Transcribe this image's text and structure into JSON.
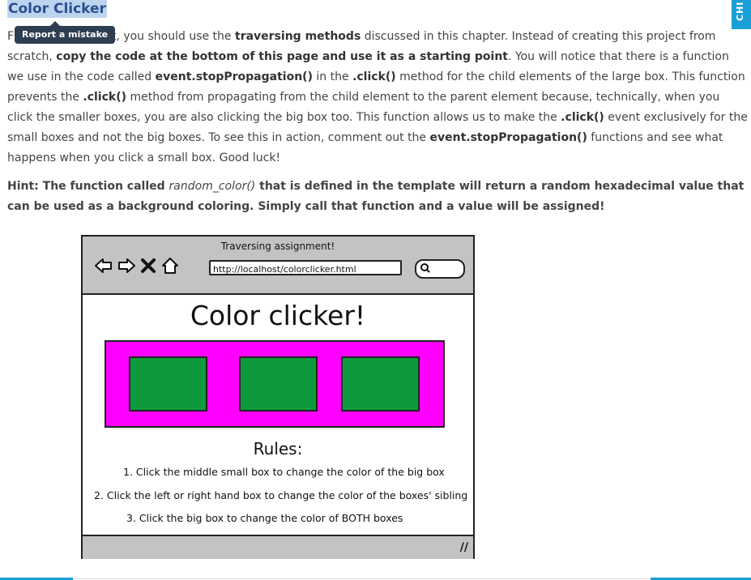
{
  "section_title": "Color Clicker",
  "tooltip": "Report a mistake",
  "side_tab": "CHI",
  "intro": {
    "lead_hidden": "F",
    "t1": "nt, you should use the ",
    "b1": "traversing methods",
    "t2": " discussed in this chapter. Instead of creating this project from scratch, ",
    "b2": "copy the code at the bottom of this page and use it as a starting point",
    "t3": ". You will notice that there is a function we use in the code called ",
    "b3": "event.stopPropagation()",
    "t4": " in the ",
    "b4": ".click()",
    "t5": " method for the child elements of the large box. This function prevents the ",
    "b5": ".click()",
    "t6": " method from propagating from the child element to the parent element because, technically, when you click the smaller boxes, you are also clicking the big box too. This function allows us to make the ",
    "b6": ".click()",
    "t7": " event exclusively for the small boxes and not the big boxes. To see this in action, comment out the ",
    "b7": "event.stopPropagation()",
    "t8": " functions and see what happens when you click a small box. Good luck!"
  },
  "hint": {
    "h1": "Hint: The function called ",
    "fn": "random_color()",
    "h2": " that is defined in the template will return a random hexadecimal value that can be used as a background coloring. Simply call that function and a value will be assigned!"
  },
  "mockup": {
    "window_title": "Traversing assignment!",
    "url": "http://localhost/colorclicker.html",
    "heading": "Color clicker!",
    "rules_title": "Rules:",
    "rules": [
      "1.  Click the middle small box to change the color of the big box",
      "2.  Click the left or right hand box to change the color of the boxes' sibling",
      "3.  Click the big box to change the color of BOTH boxes"
    ],
    "resize_glyph": "//",
    "colors": {
      "big_box": "#ff00ff",
      "small_box": "#0e9a3c",
      "chrome": "#c3c3c3"
    }
  },
  "colors": {
    "accent": "#1a9fd6",
    "title_highlight": "#bcd4ee",
    "tooltip_bg": "#2d3e50"
  }
}
